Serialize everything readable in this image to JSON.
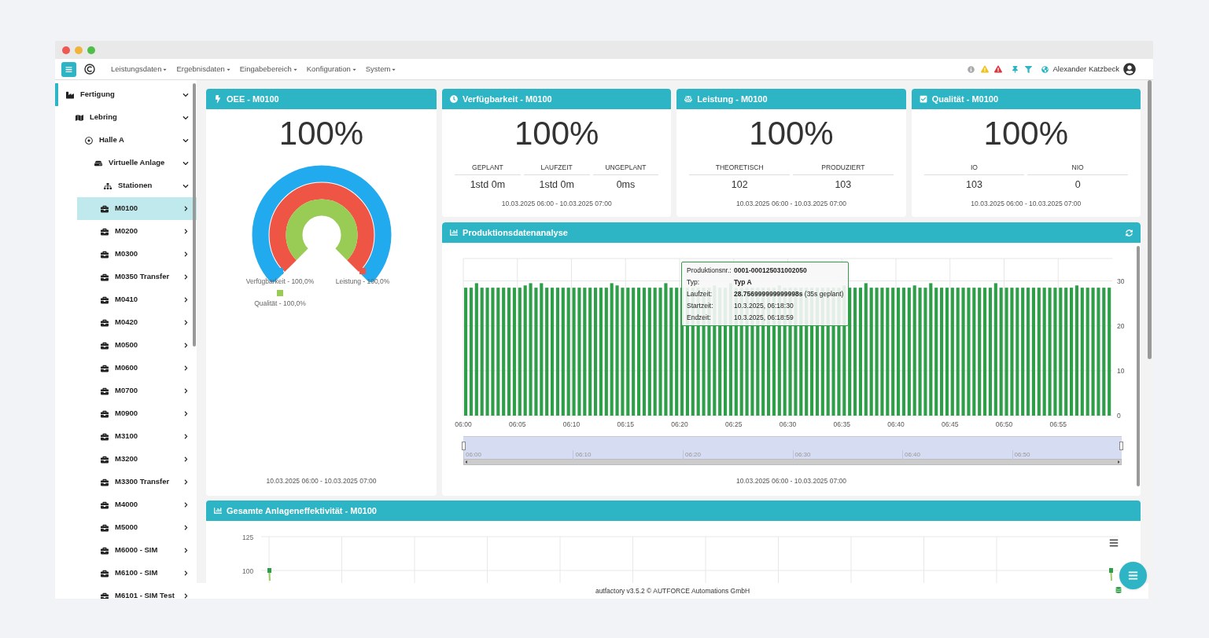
{
  "navbar": {
    "menus": [
      "Leistungsdaten",
      "Ergebnisdaten",
      "Eingabebereich",
      "Konfiguration",
      "System"
    ],
    "user": "Alexander Katzbeck"
  },
  "sidebar": {
    "items": [
      {
        "label": "Fertigung",
        "expanded": true,
        "selected": false,
        "children": [
          {
            "label": "Lebring",
            "expanded": true,
            "selected": false,
            "children": [
              {
                "label": "Halle A",
                "expanded": true,
                "selected": false,
                "children": [
                  {
                    "label": "Virtuelle Anlage",
                    "expanded": true,
                    "selected": false,
                    "children": [
                      {
                        "label": "Stationen",
                        "expanded": true,
                        "selected": false,
                        "children": [
                          {
                            "label": "M0100",
                            "expanded": false,
                            "selected": true
                          },
                          {
                            "label": "M0200",
                            "expanded": false,
                            "selected": false
                          },
                          {
                            "label": "M0300",
                            "expanded": false,
                            "selected": false
                          },
                          {
                            "label": "M0350 Transfer",
                            "expanded": false,
                            "selected": false
                          },
                          {
                            "label": "M0410",
                            "expanded": false,
                            "selected": false
                          },
                          {
                            "label": "M0420",
                            "expanded": false,
                            "selected": false
                          },
                          {
                            "label": "M0500",
                            "expanded": false,
                            "selected": false
                          },
                          {
                            "label": "M0600",
                            "expanded": false,
                            "selected": false
                          },
                          {
                            "label": "M0700",
                            "expanded": false,
                            "selected": false
                          },
                          {
                            "label": "M0900",
                            "expanded": false,
                            "selected": false
                          },
                          {
                            "label": "M3100",
                            "expanded": false,
                            "selected": false
                          },
                          {
                            "label": "M3200",
                            "expanded": false,
                            "selected": false
                          },
                          {
                            "label": "M3300 Transfer",
                            "expanded": false,
                            "selected": false
                          },
                          {
                            "label": "M4000",
                            "expanded": false,
                            "selected": false
                          },
                          {
                            "label": "M5000",
                            "expanded": false,
                            "selected": false
                          },
                          {
                            "label": "M6000 - SIM",
                            "expanded": false,
                            "selected": false
                          },
                          {
                            "label": "M6100 - SIM",
                            "expanded": false,
                            "selected": false
                          },
                          {
                            "label": "M6101 - SIM Test",
                            "expanded": false,
                            "selected": false
                          }
                        ]
                      }
                    ]
                  }
                ]
              }
            ]
          }
        ]
      }
    ]
  },
  "oee": {
    "title": "OEE - M0100",
    "value": "100%",
    "gauge": [
      {
        "name": "Verfügbarkeit - 100,0%",
        "color": "#22aaee"
      },
      {
        "name": "Leistung - 100,0%",
        "color": "#ee5544"
      },
      {
        "name": "Qualität - 100,0%",
        "color": "#99cc55"
      }
    ],
    "range": "10.03.2025 06:00 - 10.03.2025 07:00"
  },
  "kpis": [
    {
      "title": "Verfügbarkeit - M0100",
      "value": "100%",
      "columns": [
        {
          "label": "GEPLANT",
          "value": "1std 0m"
        },
        {
          "label": "LAUFZEIT",
          "value": "1std 0m"
        },
        {
          "label": "UNGEPLANT",
          "value": "0ms"
        }
      ],
      "range": "10.03.2025 06:00 - 10.03.2025 07:00"
    },
    {
      "title": "Leistung - M0100",
      "value": "100%",
      "columns": [
        {
          "label": "THEORETISCH",
          "value": "102"
        },
        {
          "label": "PRODUZIERT",
          "value": "103"
        }
      ],
      "range": "10.03.2025 06:00 - 10.03.2025 07:00"
    },
    {
      "title": "Qualität - M0100",
      "value": "100%",
      "columns": [
        {
          "label": "IO",
          "value": "103"
        },
        {
          "label": "NIO",
          "value": "0"
        }
      ],
      "range": "10.03.2025 06:00 - 10.03.2025 07:00"
    }
  ],
  "production": {
    "title": "Produktionsdatenanalyse",
    "x_axis_labels": [
      "06:00",
      "06:05",
      "06:10",
      "06:15",
      "06:20",
      "06:25",
      "06:30",
      "06:35",
      "06:40",
      "06:45",
      "06:50",
      "06:55"
    ],
    "chart_data": {
      "type": "bar",
      "grid": true,
      "ylim": [
        0,
        35
      ],
      "yticks": [
        0,
        10,
        20,
        30
      ],
      "series": [
        {
          "color": "#2e9e48",
          "values": [
            28.5,
            28.5,
            29.5,
            28.5,
            28.5,
            28.5,
            28.5,
            28.5,
            28.5,
            28.5,
            28.5,
            29,
            29.5,
            28.5,
            29.5,
            28.5,
            28.5,
            28.5,
            28.5,
            28.5,
            28.5,
            28.5,
            28.5,
            28.5,
            28.5,
            28.5,
            28.5,
            29.5,
            29,
            28.5,
            28.5,
            28.5,
            28.5,
            28.5,
            28.5,
            28.5,
            28.5,
            29.5,
            28.5,
            28.5,
            28.5,
            28.5,
            28.5,
            28.5,
            28.5,
            28.5,
            29,
            28.5,
            28.5,
            29.5,
            28.5,
            28.5,
            28.5,
            28.5,
            28.5,
            28.5,
            28.5,
            28.5,
            29,
            28.5,
            28.5,
            28.5,
            28.5,
            28.5,
            28.5,
            28.5,
            28.5,
            28.5,
            28.5,
            28.5,
            29,
            28.5,
            28.5,
            28.5,
            29.5,
            28.5,
            28.5,
            28.5,
            28.5,
            28.5,
            28.5,
            28.5,
            28.5,
            29,
            28.5,
            28.5,
            29.5,
            28.5,
            28.5,
            28.5,
            28.5,
            28.5,
            28.5,
            28.5,
            28.5,
            28.5,
            28.5,
            28.5,
            29.5,
            28.5,
            28.5,
            28.5,
            28.5,
            28.5,
            28.5,
            28.5,
            28.5,
            28.5,
            28.5,
            28.5,
            28.5,
            28.5,
            28.5,
            29,
            28.5,
            28.5,
            28.5,
            28.5,
            28.5,
            28.5
          ]
        }
      ]
    },
    "tooltip": [
      {
        "label": "Produktionsnr.:",
        "value": "0001-000125031002050",
        "strong": true
      },
      {
        "label": "Typ:",
        "value": "Typ A",
        "strong": true
      },
      {
        "label": "Laufzeit:",
        "value": "**28.756999999999998s** (35s geplant)",
        "strong": false
      },
      {
        "label": "Startzeit:",
        "value": "10.3.2025, 06:18:30",
        "strong": false
      },
      {
        "label": "Endzeit:",
        "value": "10.3.2025, 06:18:59",
        "strong": false
      }
    ],
    "navigator": [
      "06:00",
      "06:10",
      "06:20",
      "06:30",
      "06:40",
      "06:50"
    ],
    "range": "10.03.2025 06:00 - 10.03.2025 07:00"
  },
  "oee_chart": {
    "title": "Gesamte Anlageneffektivität - M0100",
    "y_tick_labels": [
      "125",
      "100"
    ]
  },
  "footer": "autfactory v3.5.2 © AUTFORCE Automations GmbH"
}
